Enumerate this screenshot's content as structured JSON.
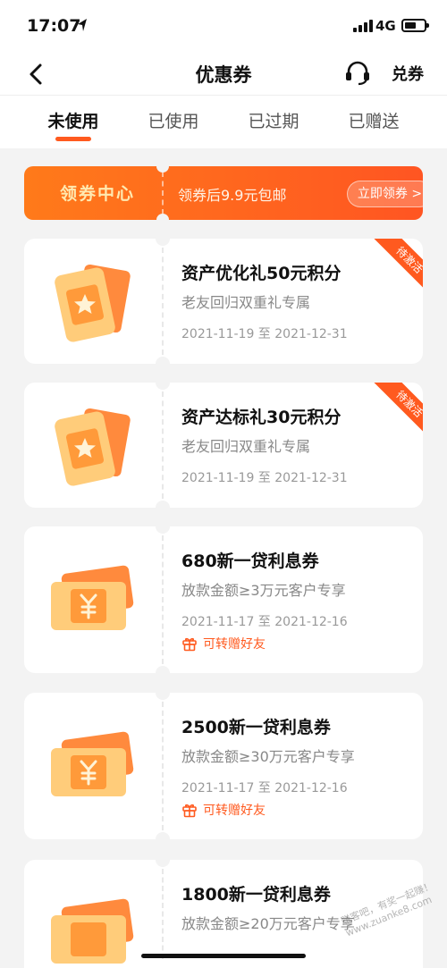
{
  "status_bar": {
    "time": "17:07",
    "network": "4G"
  },
  "nav": {
    "title": "优惠券",
    "redeem_label": "兑券"
  },
  "tabs": [
    {
      "label": "未使用",
      "active": true
    },
    {
      "label": "已使用"
    },
    {
      "label": "已过期"
    },
    {
      "label": "已赠送"
    }
  ],
  "banner": {
    "title": "领券中心",
    "subtitle": "领券后9.9元包邮",
    "button": "立即领券 >"
  },
  "coupons": [
    {
      "title": "资产优化礼50元积分",
      "desc": "老友回归双重礼专属",
      "date": "2021-11-19 至 2021-12-31",
      "badge": "待激活",
      "icon": "star-ticket-icon"
    },
    {
      "title": "资产达标礼30元积分",
      "desc": "老友回归双重礼专属",
      "date": "2021-11-19 至 2021-12-31",
      "badge": "待激活",
      "icon": "star-ticket-icon"
    },
    {
      "title": "680新一贷利息券",
      "desc": "放款金额≥3万元客户专享",
      "date": "2021-11-17 至 2021-12-16",
      "gift": "可转赠好友",
      "icon": "yuan-ticket-icon"
    },
    {
      "title": "2500新一贷利息券",
      "desc": "放款金额≥30万元客户专享",
      "date": "2021-11-17 至 2021-12-16",
      "gift": "可转赠好友",
      "icon": "yuan-ticket-icon"
    },
    {
      "title": "1800新一贷利息券",
      "desc": "放款金额≥20万元客户专享",
      "icon": "yuan-ticket-icon"
    }
  ],
  "watermark": "赚客吧，有奖一起赚！ www.zuanke8.com",
  "colors": {
    "accent": "#ff5a1f",
    "banner_start": "#ff7a1a",
    "banner_end": "#ff5522",
    "page_bg": "#f3f3f3"
  }
}
